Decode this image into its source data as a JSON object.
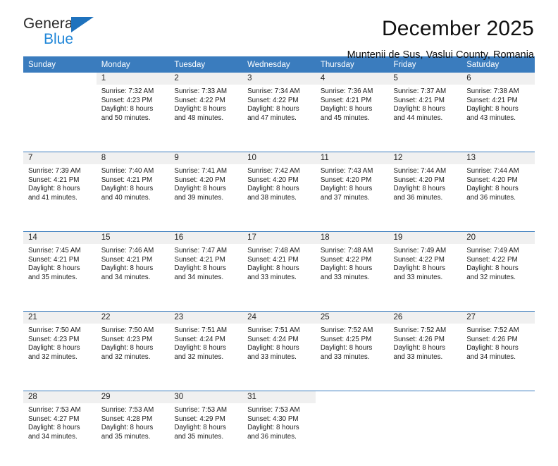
{
  "brand": {
    "name_part1": "General",
    "name_part2": "Blue",
    "triangle_color": "#1f72bd",
    "blue_text_color": "#1f86d8"
  },
  "header": {
    "title": "December 2025",
    "location": "Muntenii de Sus, Vaslui County, Romania"
  },
  "theme": {
    "header_bg": "#3a7cbe",
    "header_text": "#ffffff",
    "daynum_bg": "#f0f0f0",
    "grid_line": "#3a7cbe"
  },
  "calendar": {
    "weekday_headers": [
      "Sunday",
      "Monday",
      "Tuesday",
      "Wednesday",
      "Thursday",
      "Friday",
      "Saturday"
    ],
    "weeks": [
      [
        {
          "day": "",
          "sunrise": "",
          "sunset": "",
          "daylight_line1": "",
          "daylight_line2": ""
        },
        {
          "day": "1",
          "sunrise": "Sunrise: 7:32 AM",
          "sunset": "Sunset: 4:23 PM",
          "daylight_line1": "Daylight: 8 hours",
          "daylight_line2": "and 50 minutes."
        },
        {
          "day": "2",
          "sunrise": "Sunrise: 7:33 AM",
          "sunset": "Sunset: 4:22 PM",
          "daylight_line1": "Daylight: 8 hours",
          "daylight_line2": "and 48 minutes."
        },
        {
          "day": "3",
          "sunrise": "Sunrise: 7:34 AM",
          "sunset": "Sunset: 4:22 PM",
          "daylight_line1": "Daylight: 8 hours",
          "daylight_line2": "and 47 minutes."
        },
        {
          "day": "4",
          "sunrise": "Sunrise: 7:36 AM",
          "sunset": "Sunset: 4:21 PM",
          "daylight_line1": "Daylight: 8 hours",
          "daylight_line2": "and 45 minutes."
        },
        {
          "day": "5",
          "sunrise": "Sunrise: 7:37 AM",
          "sunset": "Sunset: 4:21 PM",
          "daylight_line1": "Daylight: 8 hours",
          "daylight_line2": "and 44 minutes."
        },
        {
          "day": "6",
          "sunrise": "Sunrise: 7:38 AM",
          "sunset": "Sunset: 4:21 PM",
          "daylight_line1": "Daylight: 8 hours",
          "daylight_line2": "and 43 minutes."
        }
      ],
      [
        {
          "day": "7",
          "sunrise": "Sunrise: 7:39 AM",
          "sunset": "Sunset: 4:21 PM",
          "daylight_line1": "Daylight: 8 hours",
          "daylight_line2": "and 41 minutes."
        },
        {
          "day": "8",
          "sunrise": "Sunrise: 7:40 AM",
          "sunset": "Sunset: 4:21 PM",
          "daylight_line1": "Daylight: 8 hours",
          "daylight_line2": "and 40 minutes."
        },
        {
          "day": "9",
          "sunrise": "Sunrise: 7:41 AM",
          "sunset": "Sunset: 4:20 PM",
          "daylight_line1": "Daylight: 8 hours",
          "daylight_line2": "and 39 minutes."
        },
        {
          "day": "10",
          "sunrise": "Sunrise: 7:42 AM",
          "sunset": "Sunset: 4:20 PM",
          "daylight_line1": "Daylight: 8 hours",
          "daylight_line2": "and 38 minutes."
        },
        {
          "day": "11",
          "sunrise": "Sunrise: 7:43 AM",
          "sunset": "Sunset: 4:20 PM",
          "daylight_line1": "Daylight: 8 hours",
          "daylight_line2": "and 37 minutes."
        },
        {
          "day": "12",
          "sunrise": "Sunrise: 7:44 AM",
          "sunset": "Sunset: 4:20 PM",
          "daylight_line1": "Daylight: 8 hours",
          "daylight_line2": "and 36 minutes."
        },
        {
          "day": "13",
          "sunrise": "Sunrise: 7:44 AM",
          "sunset": "Sunset: 4:20 PM",
          "daylight_line1": "Daylight: 8 hours",
          "daylight_line2": "and 36 minutes."
        }
      ],
      [
        {
          "day": "14",
          "sunrise": "Sunrise: 7:45 AM",
          "sunset": "Sunset: 4:21 PM",
          "daylight_line1": "Daylight: 8 hours",
          "daylight_line2": "and 35 minutes."
        },
        {
          "day": "15",
          "sunrise": "Sunrise: 7:46 AM",
          "sunset": "Sunset: 4:21 PM",
          "daylight_line1": "Daylight: 8 hours",
          "daylight_line2": "and 34 minutes."
        },
        {
          "day": "16",
          "sunrise": "Sunrise: 7:47 AM",
          "sunset": "Sunset: 4:21 PM",
          "daylight_line1": "Daylight: 8 hours",
          "daylight_line2": "and 34 minutes."
        },
        {
          "day": "17",
          "sunrise": "Sunrise: 7:48 AM",
          "sunset": "Sunset: 4:21 PM",
          "daylight_line1": "Daylight: 8 hours",
          "daylight_line2": "and 33 minutes."
        },
        {
          "day": "18",
          "sunrise": "Sunrise: 7:48 AM",
          "sunset": "Sunset: 4:22 PM",
          "daylight_line1": "Daylight: 8 hours",
          "daylight_line2": "and 33 minutes."
        },
        {
          "day": "19",
          "sunrise": "Sunrise: 7:49 AM",
          "sunset": "Sunset: 4:22 PM",
          "daylight_line1": "Daylight: 8 hours",
          "daylight_line2": "and 33 minutes."
        },
        {
          "day": "20",
          "sunrise": "Sunrise: 7:49 AM",
          "sunset": "Sunset: 4:22 PM",
          "daylight_line1": "Daylight: 8 hours",
          "daylight_line2": "and 32 minutes."
        }
      ],
      [
        {
          "day": "21",
          "sunrise": "Sunrise: 7:50 AM",
          "sunset": "Sunset: 4:23 PM",
          "daylight_line1": "Daylight: 8 hours",
          "daylight_line2": "and 32 minutes."
        },
        {
          "day": "22",
          "sunrise": "Sunrise: 7:50 AM",
          "sunset": "Sunset: 4:23 PM",
          "daylight_line1": "Daylight: 8 hours",
          "daylight_line2": "and 32 minutes."
        },
        {
          "day": "23",
          "sunrise": "Sunrise: 7:51 AM",
          "sunset": "Sunset: 4:24 PM",
          "daylight_line1": "Daylight: 8 hours",
          "daylight_line2": "and 32 minutes."
        },
        {
          "day": "24",
          "sunrise": "Sunrise: 7:51 AM",
          "sunset": "Sunset: 4:24 PM",
          "daylight_line1": "Daylight: 8 hours",
          "daylight_line2": "and 33 minutes."
        },
        {
          "day": "25",
          "sunrise": "Sunrise: 7:52 AM",
          "sunset": "Sunset: 4:25 PM",
          "daylight_line1": "Daylight: 8 hours",
          "daylight_line2": "and 33 minutes."
        },
        {
          "day": "26",
          "sunrise": "Sunrise: 7:52 AM",
          "sunset": "Sunset: 4:26 PM",
          "daylight_line1": "Daylight: 8 hours",
          "daylight_line2": "and 33 minutes."
        },
        {
          "day": "27",
          "sunrise": "Sunrise: 7:52 AM",
          "sunset": "Sunset: 4:26 PM",
          "daylight_line1": "Daylight: 8 hours",
          "daylight_line2": "and 34 minutes."
        }
      ],
      [
        {
          "day": "28",
          "sunrise": "Sunrise: 7:53 AM",
          "sunset": "Sunset: 4:27 PM",
          "daylight_line1": "Daylight: 8 hours",
          "daylight_line2": "and 34 minutes."
        },
        {
          "day": "29",
          "sunrise": "Sunrise: 7:53 AM",
          "sunset": "Sunset: 4:28 PM",
          "daylight_line1": "Daylight: 8 hours",
          "daylight_line2": "and 35 minutes."
        },
        {
          "day": "30",
          "sunrise": "Sunrise: 7:53 AM",
          "sunset": "Sunset: 4:29 PM",
          "daylight_line1": "Daylight: 8 hours",
          "daylight_line2": "and 35 minutes."
        },
        {
          "day": "31",
          "sunrise": "Sunrise: 7:53 AM",
          "sunset": "Sunset: 4:30 PM",
          "daylight_line1": "Daylight: 8 hours",
          "daylight_line2": "and 36 minutes."
        },
        {
          "day": "",
          "sunrise": "",
          "sunset": "",
          "daylight_line1": "",
          "daylight_line2": ""
        },
        {
          "day": "",
          "sunrise": "",
          "sunset": "",
          "daylight_line1": "",
          "daylight_line2": ""
        },
        {
          "day": "",
          "sunrise": "",
          "sunset": "",
          "daylight_line1": "",
          "daylight_line2": ""
        }
      ]
    ]
  }
}
